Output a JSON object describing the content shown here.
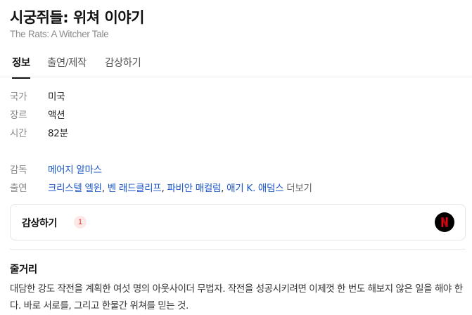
{
  "header": {
    "title": "시궁쥐들: 위쳐 이야기",
    "original_title": "The Rats: A Witcher Tale"
  },
  "tabs": [
    {
      "label": "정보",
      "active": true
    },
    {
      "label": "출연/제작",
      "active": false
    },
    {
      "label": "감상하기",
      "active": false
    }
  ],
  "info": {
    "country": {
      "key": "국가",
      "value": "미국"
    },
    "genre": {
      "key": "장르",
      "value": "액션"
    },
    "runtime": {
      "key": "시간",
      "value": "82분"
    }
  },
  "credits": {
    "director": {
      "key": "감독",
      "name": "메어지 알마스"
    },
    "cast": {
      "key": "출연",
      "names": [
        "크리스텔 엘윈",
        "벤 래드클리프",
        "파비안 매컬럼",
        "애기 K. 애덤스"
      ],
      "separator": ",",
      "more_label": "더보기"
    }
  },
  "watch": {
    "label": "감상하기",
    "count": "1",
    "provider_icon": "netflix-logo-icon",
    "provider_color": "#e50914"
  },
  "synopsis": {
    "title": "줄거리",
    "text": "대담한 강도 작전을 계획한 여섯 명의 아웃사이더 무법자. 작전을 성공시키려면 이제껏 한 번도 해보지 않은 일을 해야 한다. 바로 서로를, 그리고 한물간 위쳐를 믿는 것."
  },
  "colors": {
    "link": "#1a56c7",
    "muted": "#888888",
    "badge_text": "#e03535"
  }
}
